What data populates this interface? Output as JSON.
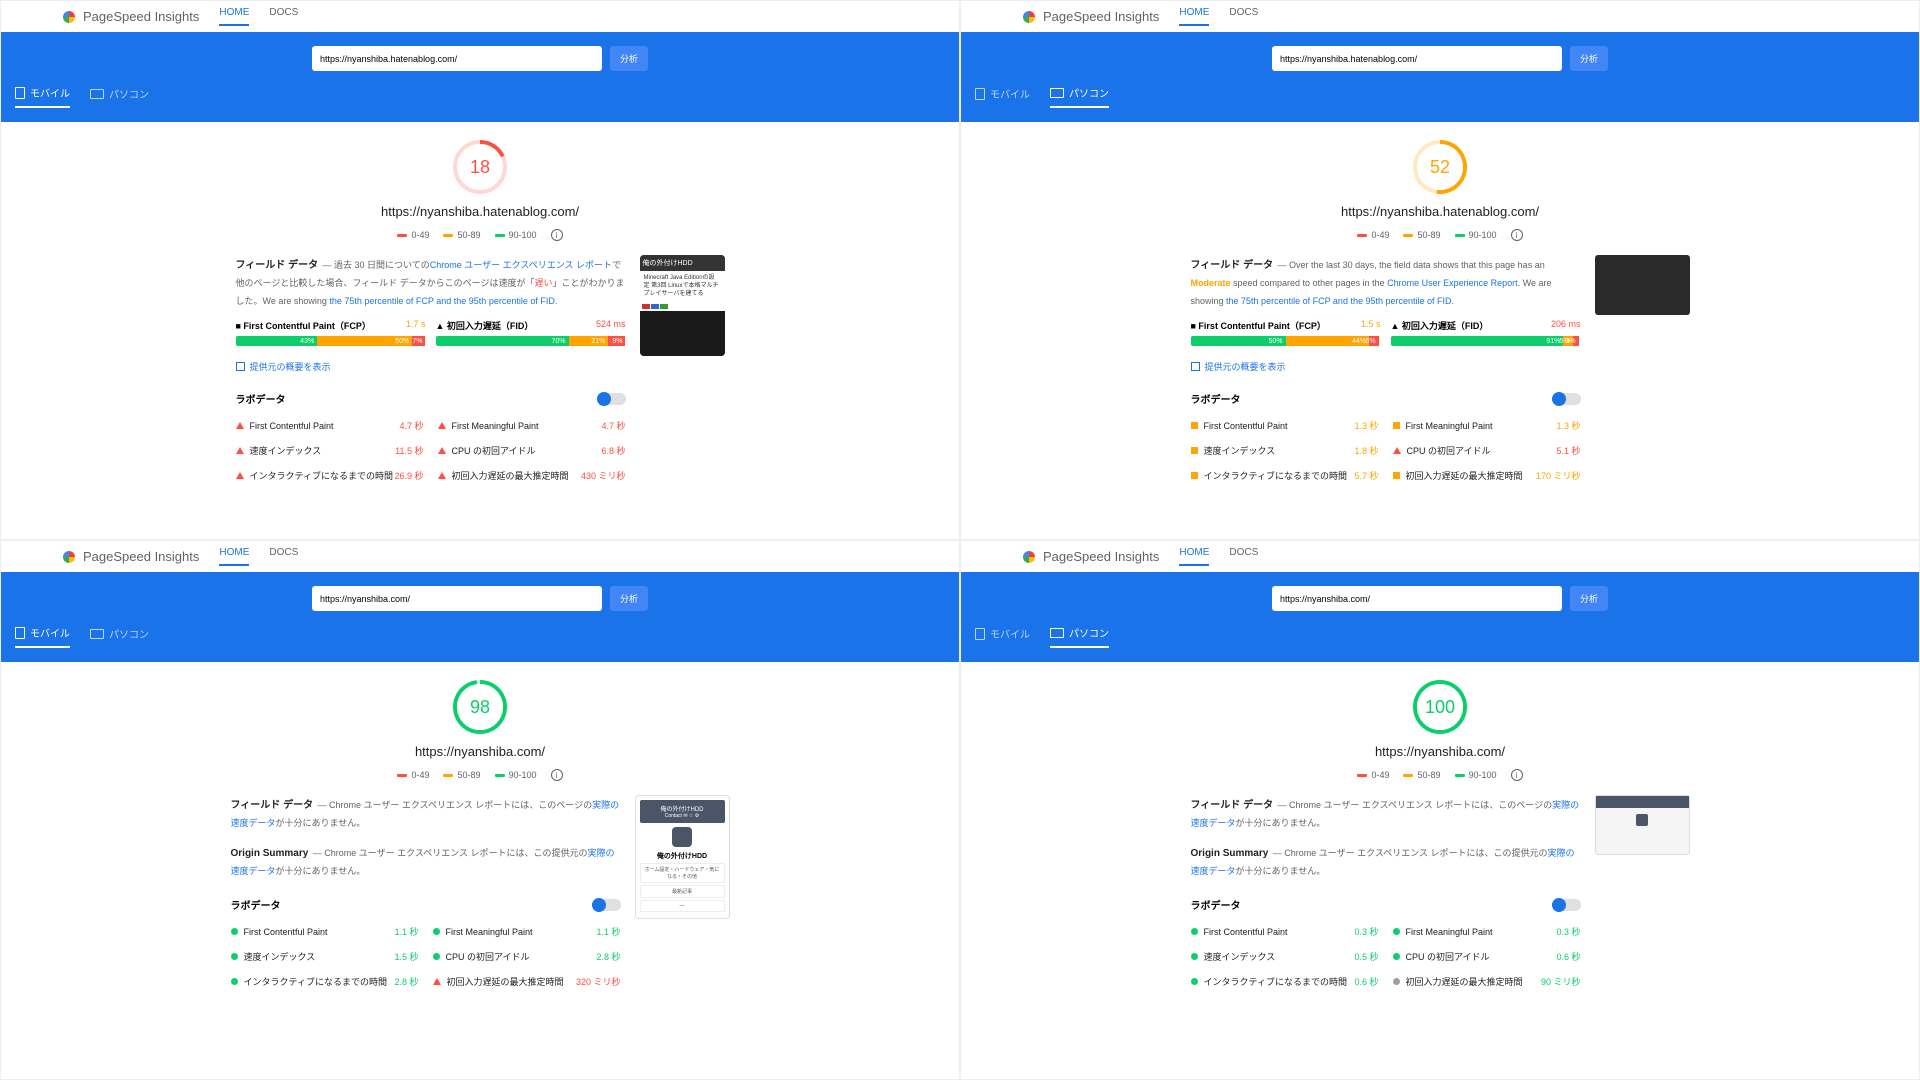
{
  "app_name": "PageSpeed Insights",
  "nav": {
    "home": "HOME",
    "docs": "DOCS"
  },
  "analyze_btn": "分析",
  "device": {
    "mobile": "モバイル",
    "desktop": "パソコン"
  },
  "legend": {
    "low": "0-49",
    "mid": "50-89",
    "high": "90-100"
  },
  "field_data_label": "フィールド データ",
  "origin_summary_label": "Origin Summary",
  "lab_data_label": "ラボデータ",
  "origin_toggle": "提供元の概要を表示",
  "metrics": {
    "fcp": "First Contentful Paint（FCP）",
    "fid": "初回入力遅延（FID）",
    "fcp_short": "First Contentful Paint",
    "fmp": "First Meaningful Paint",
    "si": "速度インデックス",
    "cpu": "CPU の初回アイドル",
    "tti": "インタラクティブになるまでの時間",
    "mfid": "初回入力遅延の最大推定時間"
  },
  "panels": [
    {
      "url_input": "https://nyanshiba.hatenablog.com/",
      "url_display": "https://nyanshiba.hatenablog.com/",
      "active_device": "mobile",
      "score": 18,
      "score_class": "score-red",
      "field_desc_pre": "— 過去 30 日間についての",
      "field_desc_link1": "Chrome ユーザー エクスペリエンス レポート",
      "field_desc_mid": "で他のページと比較した場合、フィールド データからこのページは速度が「",
      "field_desc_speed": "遅い",
      "speed_class": "highlight-slow",
      "field_desc_post": "」ことがわかりました。We are showing ",
      "field_desc_link2": "the 75th percentile of FCP and the 95th percentile of FID",
      "fcp_val": "1.7 s",
      "fcp_class": "val-orange",
      "fid_val": "524 ms",
      "fid_class": "val-red",
      "fcp_bar": [
        [
          "43%",
          "bg-green",
          "43%"
        ],
        [
          "50%",
          "bg-orange",
          "50%"
        ],
        [
          "7%",
          "bg-red",
          "7%"
        ]
      ],
      "fid_bar": [
        [
          "70%",
          "bg-green",
          "70%"
        ],
        [
          "21%",
          "bg-orange",
          "21%"
        ],
        [
          "9%",
          "bg-red",
          "9%"
        ]
      ],
      "has_field_bars": true,
      "preview_type": "mobile_dark",
      "preview_title": "俺の外付けHDD",
      "preview_body": "Minecraft Java Editionの設定 第3回 Linuxで本格マルチプレイサーバを建てる",
      "lab": [
        {
          "name": "fcp_short",
          "val": "4.7 秒",
          "cls": "val-red",
          "icon": "tri-red"
        },
        {
          "name": "fmp",
          "val": "4.7 秒",
          "cls": "val-red",
          "icon": "tri-red"
        },
        {
          "name": "si",
          "val": "11.5 秒",
          "cls": "val-red",
          "icon": "tri-red"
        },
        {
          "name": "cpu",
          "val": "6.8 秒",
          "cls": "val-red",
          "icon": "tri-red"
        },
        {
          "name": "tti",
          "val": "26.9 秒",
          "cls": "val-red",
          "icon": "tri-red"
        },
        {
          "name": "mfid",
          "val": "430 ミリ秒",
          "cls": "val-red",
          "icon": "tri-red"
        }
      ]
    },
    {
      "url_input": "https://nyanshiba.hatenablog.com/",
      "url_display": "https://nyanshiba.hatenablog.com/",
      "active_device": "desktop",
      "score": 52,
      "score_class": "score-orange",
      "field_desc_pre": "— Over the last 30 days, the field data shows that this page has an ",
      "field_desc_speed": "Moderate",
      "speed_class": "highlight-mod",
      "field_desc_mid2": " speed compared to other pages in the ",
      "field_desc_link1": "Chrome User Experience Report",
      "field_desc_post": ". We are showing ",
      "field_desc_link2": "the 75th percentile of FCP and the 95th percentile of FID",
      "fcp_val": "1.5 s",
      "fcp_class": "val-orange",
      "fid_val": "206 ms",
      "fid_class": "val-red",
      "fcp_bar": [
        [
          "50%",
          "bg-green",
          "50%"
        ],
        [
          "44%",
          "bg-orange",
          "44%"
        ],
        [
          "5%",
          "bg-red",
          "5%"
        ]
      ],
      "fid_bar": [
        [
          "91%",
          "bg-green",
          "91%"
        ],
        [
          "5%",
          "bg-orange",
          "5%"
        ],
        [
          "3%",
          "bg-red",
          "3%"
        ]
      ],
      "has_field_bars": true,
      "preview_type": "desktop_dark",
      "lab": [
        {
          "name": "fcp_short",
          "val": "1.3 秒",
          "cls": "val-orange",
          "icon": "sq-orange"
        },
        {
          "name": "fmp",
          "val": "1.3 秒",
          "cls": "val-orange",
          "icon": "sq-orange"
        },
        {
          "name": "si",
          "val": "1.8 秒",
          "cls": "val-orange",
          "icon": "sq-orange"
        },
        {
          "name": "cpu",
          "val": "5.1 秒",
          "cls": "val-red",
          "icon": "tri-red"
        },
        {
          "name": "tti",
          "val": "5.7 秒",
          "cls": "val-orange",
          "icon": "sq-orange"
        },
        {
          "name": "mfid",
          "val": "170 ミリ秒",
          "cls": "val-orange",
          "icon": "sq-orange"
        }
      ]
    },
    {
      "url_input": "https://nyanshiba.com/",
      "url_display": "https://nyanshiba.com/",
      "active_device": "mobile",
      "score": 98,
      "score_class": "score-green",
      "no_field_pre": "— Chrome ユーザー エクスペリエンス レポートには、このページの",
      "no_field_link": "実際の速度データ",
      "no_field_post": "が十分にありません。",
      "origin_pre": "— Chrome ユーザー エクスペリエンス レポートには、この提供元の",
      "origin_link": "実際の速度データ",
      "origin_post": "が十分にありません。",
      "has_field_bars": false,
      "preview_type": "mobile_light",
      "preview_title": "俺の外付けHDD",
      "lab": [
        {
          "name": "fcp_short",
          "val": "1.1 秒",
          "cls": "val-green",
          "icon": "cir-green"
        },
        {
          "name": "fmp",
          "val": "1.1 秒",
          "cls": "val-green",
          "icon": "cir-green"
        },
        {
          "name": "si",
          "val": "1.5 秒",
          "cls": "val-green",
          "icon": "cir-green"
        },
        {
          "name": "cpu",
          "val": "2.8 秒",
          "cls": "val-green",
          "icon": "cir-green"
        },
        {
          "name": "tti",
          "val": "2.8 秒",
          "cls": "val-green",
          "icon": "cir-green"
        },
        {
          "name": "mfid",
          "val": "320 ミリ秒",
          "cls": "val-red",
          "icon": "tri-red"
        }
      ]
    },
    {
      "url_input": "https://nyanshiba.com/",
      "url_display": "https://nyanshiba.com/",
      "active_device": "desktop",
      "score": 100,
      "score_class": "score-green100",
      "no_field_pre": "— Chrome ユーザー エクスペリエンス レポートには、このページの",
      "no_field_link": "実際の速度データ",
      "no_field_post": "が十分にありません。",
      "origin_pre": "— Chrome ユーザー エクスペリエンス レポートには、この提供元の",
      "origin_link": "実際の速度データ",
      "origin_post": "が十分にありません。",
      "has_field_bars": false,
      "preview_type": "desktop_light",
      "lab": [
        {
          "name": "fcp_short",
          "val": "0.3 秒",
          "cls": "val-green",
          "icon": "cir-green"
        },
        {
          "name": "fmp",
          "val": "0.3 秒",
          "cls": "val-green",
          "icon": "cir-green"
        },
        {
          "name": "si",
          "val": "0.5 秒",
          "cls": "val-green",
          "icon": "cir-green"
        },
        {
          "name": "cpu",
          "val": "0.6 秒",
          "cls": "val-green",
          "icon": "cir-green"
        },
        {
          "name": "tti",
          "val": "0.6 秒",
          "cls": "val-green",
          "icon": "cir-green"
        },
        {
          "name": "mfid",
          "val": "90 ミリ秒",
          "cls": "val-green",
          "icon": "cir-gray"
        }
      ]
    }
  ]
}
